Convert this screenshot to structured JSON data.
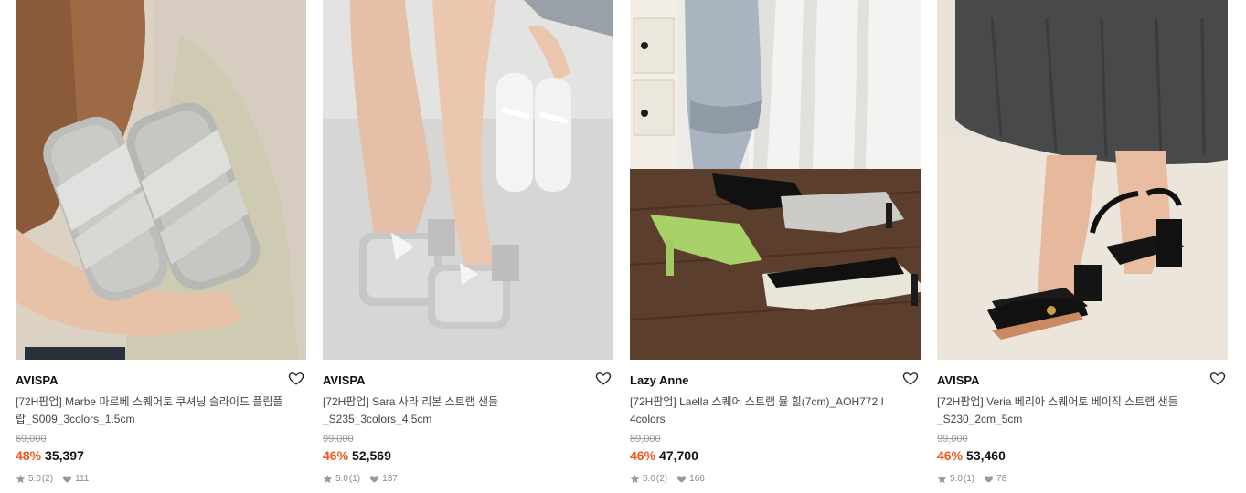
{
  "products": [
    {
      "brand": "AVISPA",
      "name": "[72H팝업] Marbe 마르베 스퀘어토 쿠셔닝 슬라이드 플립플랍_S009_3colors_1.5cm",
      "original_price": "69,000",
      "discount": "48%",
      "price": "35,397",
      "rating": "5.0",
      "review_count": "(2)",
      "likes": "111",
      "image": "woman-holding-silver-cross-strap-slides",
      "colors": {
        "bg": "#ddd3c6",
        "accent": "#cfd0cd"
      }
    },
    {
      "brand": "AVISPA",
      "name": "[72H팝업] Sara 사라 리본 스트랩 샌들 _S235_3colors_4.5cm",
      "original_price": "99,000",
      "discount": "46%",
      "price": "52,569",
      "rating": "5.0",
      "review_count": "(1)",
      "likes": "137",
      "image": "legs-wearing-silver-ribbon-sandals",
      "colors": {
        "bg": "#d4d4d2",
        "accent": "#e6e7e8"
      }
    },
    {
      "brand": "Lazy Anne",
      "name": "[72H팝업] Laella 스퀘어 스트랩 뮬 힐(7cm)_AOH772 I 4colors",
      "original_price": "89,000",
      "discount": "46%",
      "price": "47,700",
      "rating": "5.0",
      "review_count": "(2)",
      "likes": "166",
      "image": "square-toe-mule-heels-on-wood-floor",
      "colors": {
        "bg": "#5a3d2b",
        "accent": "#a9d16a"
      }
    },
    {
      "brand": "AVISPA",
      "name": "[72H팝업] Veria 베리아 스퀘어토 베이직 스트랩 샌들 _S230_2cm_5cm",
      "original_price": "99,000",
      "discount": "46%",
      "price": "53,460",
      "rating": "5.0",
      "review_count": "(1)",
      "likes": "78",
      "image": "black-strap-block-heel-sandals",
      "colors": {
        "bg": "#e9e3d9",
        "accent": "#1b1b1b"
      }
    }
  ],
  "icons": {
    "wishlist": "heart-outline-icon",
    "rating": "star-icon",
    "likes": "heart-filled-icon"
  },
  "theme": {
    "discount_color": "#f2561c",
    "meta_color": "#888888"
  }
}
